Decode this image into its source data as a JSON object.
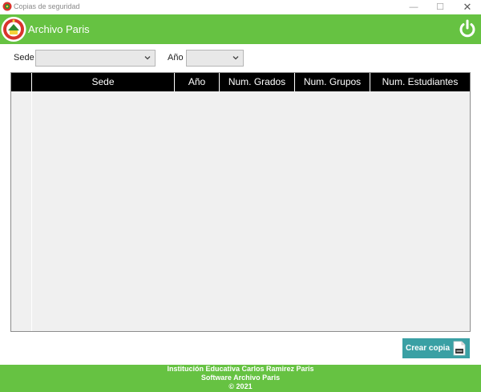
{
  "window": {
    "title": "Copias de seguridad",
    "minimize_glyph": "—",
    "maximize_glyph": "☐",
    "close_glyph": "✕"
  },
  "header": {
    "app_name": "Archivo Paris",
    "logo_icon": "school-crest-icon",
    "power_icon": "power-icon",
    "color": "#66c242"
  },
  "filters": {
    "sede_label": "Sede",
    "sede_value": "",
    "ano_label": "Año",
    "ano_value": ""
  },
  "grid": {
    "columns": [
      "",
      "Sede",
      "Año",
      "Num. Grados",
      "Num. Grupos",
      "Num. Estudiantes"
    ],
    "rows": []
  },
  "actions": {
    "create_copy_label": "Crear copia",
    "create_copy_icon": "document-file-icon",
    "color": "#3aa0a4"
  },
  "footer": {
    "line1": "Institución Educativa Carlos Ramirez Paris",
    "line2": "Software Archivo Paris",
    "line3": "© 2021"
  }
}
